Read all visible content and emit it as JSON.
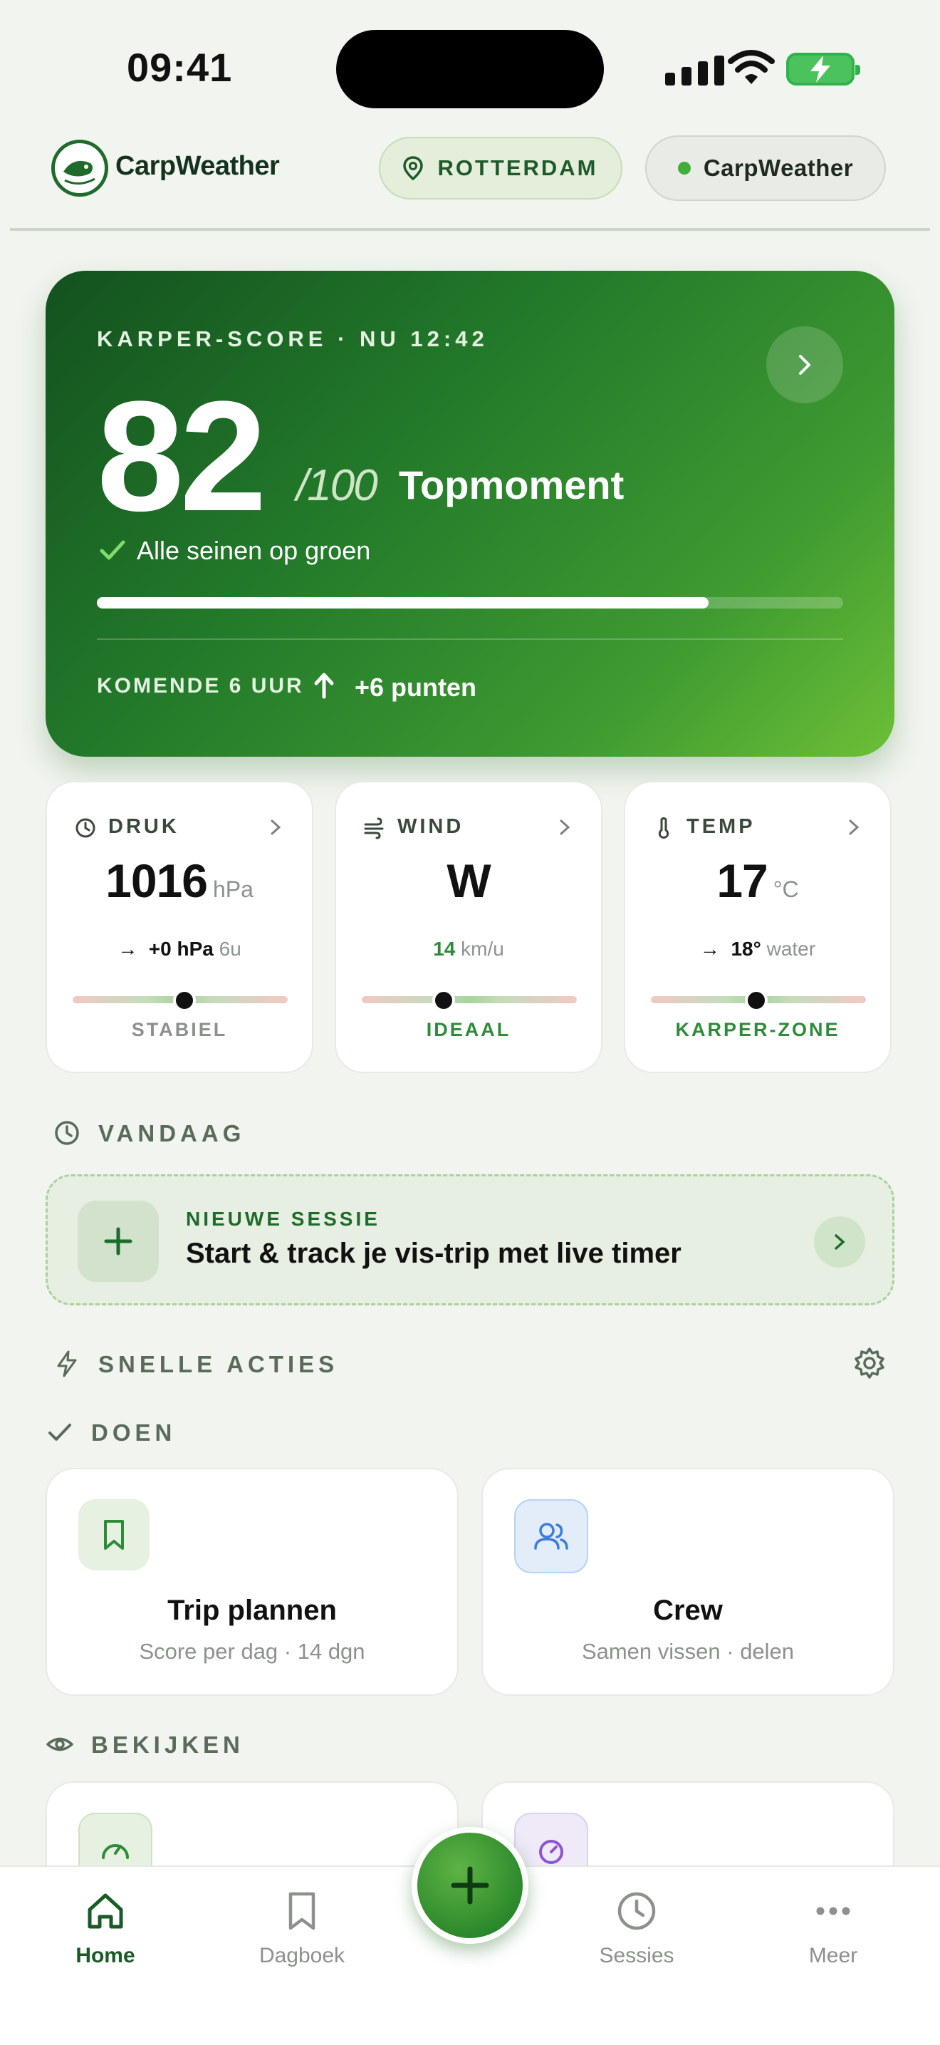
{
  "status_bar": {
    "time": "09:41"
  },
  "header": {
    "brand": "CarpWeather",
    "location": "ROTTERDAM",
    "app_pill": "CarpWeather"
  },
  "hero": {
    "kicker": "KARPER-SCORE · NU 12:42",
    "score": "82",
    "score_of": "/100",
    "score_word": "Topmoment",
    "status": "Alle seinen op groen",
    "progress_fraction": 0.82,
    "footer_label": "KOMENDE 6 UUR",
    "footer_value": "+6 punten"
  },
  "metrics": [
    {
      "label": "DRUK",
      "icon": "clock-icon",
      "value": "1016",
      "unit": "hPa",
      "sub_main": "+0 hPa",
      "sub_dim": "6u",
      "marker_fraction": 0.52,
      "tag": "STABIEL",
      "tag_color": "#8a928a"
    },
    {
      "label": "WIND",
      "icon": "wind-icon",
      "value": "W",
      "unit": "",
      "sub_main": "14",
      "sub_dim": "km/u",
      "marker_fraction": 0.38,
      "tag": "IDEAAL",
      "tag_color": "#2e8b37"
    },
    {
      "label": "TEMP",
      "icon": "thermometer-icon",
      "value": "17",
      "unit": "°C",
      "sub_main": "18°",
      "sub_dim": "water",
      "marker_fraction": 0.49,
      "tag": "KARPER-ZONE",
      "tag_color": "#2e8b37"
    }
  ],
  "today": {
    "title": "VANDAAG",
    "new_session_kicker": "NIEUWE SESSIE",
    "new_session_text": "Start & track je vis-trip met live timer"
  },
  "quick_actions": {
    "title": "SNELLE ACTIES",
    "do_title": "DOEN",
    "do_cards": [
      {
        "title": "Trip plannen",
        "subtitle": "Score per dag · 14 dgn",
        "icon": "bookmark-icon",
        "accent": "#e6f1e1"
      },
      {
        "title": "Crew",
        "subtitle": "Samen vissen · delen",
        "icon": "users-icon",
        "accent": "#e3edfa"
      }
    ],
    "view_title": "BEKIJKEN",
    "view_cards": [
      {
        "icon": "gauge-icon",
        "accent": "#e6f1e1"
      },
      {
        "icon": "timer-icon",
        "accent": "#efe9f8"
      }
    ]
  },
  "nav": [
    {
      "label": "Home",
      "icon": "home-icon",
      "active": true
    },
    {
      "label": "Dagboek",
      "icon": "bookmark-icon",
      "active": false
    },
    {
      "label": "Sessies",
      "icon": "clock-icon",
      "active": false
    },
    {
      "label": "Meer",
      "icon": "more-icon",
      "active": false
    }
  ]
}
